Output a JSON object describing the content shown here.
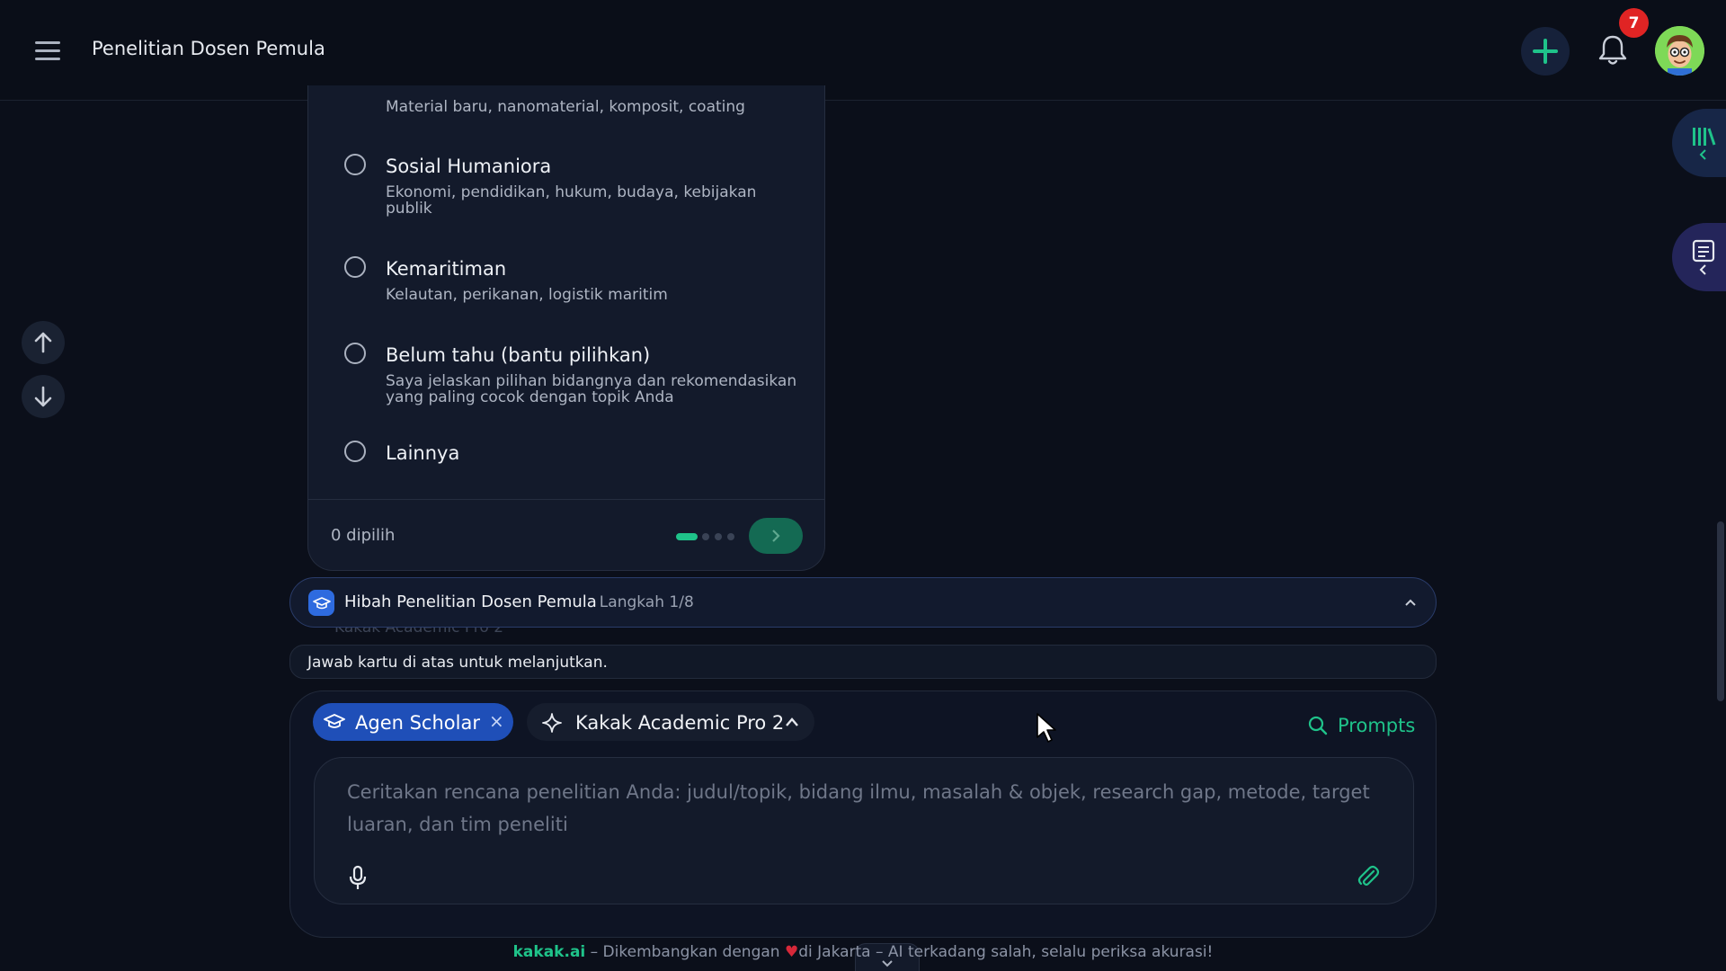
{
  "header": {
    "title": "Penelitian Dosen Pemula",
    "notification_count": "7"
  },
  "card": {
    "top_desc": "Material baru, nanomaterial, komposit, coating",
    "options": [
      {
        "title": "Sosial Humaniora",
        "desc": "Ekonomi, pendidikan, hukum, budaya, kebijakan publik"
      },
      {
        "title": "Kemaritiman",
        "desc": "Kelautan, perikanan, logistik maritim"
      },
      {
        "title": "Belum tahu (bantu pilihkan)",
        "desc": "Saya jelaskan pilihan bidangnya dan rekomendasikan yang paling cocok dengan topik Anda"
      },
      {
        "title": "Lainnya",
        "desc": ""
      }
    ],
    "selected_count": "0 dipilih",
    "pager": {
      "total": 4,
      "current": 1
    }
  },
  "workflow": {
    "title": "Hibah Penelitian Dosen Pemula",
    "step": "· Langkah 1/8",
    "ghost": "Kakak Academic Pro 2"
  },
  "hint": "Jawab kartu di atas untuk melanjutkan.",
  "composer": {
    "agent_chip": "Agen Scholar",
    "agent_chip_close": "×",
    "model_chip": "Kakak Academic Pro 2",
    "prompts_label": "Prompts",
    "placeholder": "Ceritakan rencana penelitian Anda: judul/topik, bidang ilmu, masalah & objek, research gap, metode, target luaran, dan tim peneliti"
  },
  "footer": {
    "brand": "kakak.ai",
    "text_before": " – Dikembangkan dengan ",
    "heart": "♥",
    "text_after": "di Jakarta – AI terkadang salah, selalu periksa akurasi!"
  },
  "colors": {
    "accent_green": "#1fc38a",
    "agent_blue": "#1f4fb8",
    "badge_red": "#e02424",
    "background": "#0b0f1a"
  },
  "icons": [
    "menu-icon",
    "plus-icon",
    "bell-icon",
    "avatar",
    "library-icon",
    "outline-icon",
    "arrow-up-icon",
    "arrow-down-icon",
    "graduation-cap-icon",
    "sparkle-icon",
    "chevron-up-icon",
    "search-icon",
    "mic-icon",
    "paperclip-icon",
    "chevron-down-icon"
  ]
}
